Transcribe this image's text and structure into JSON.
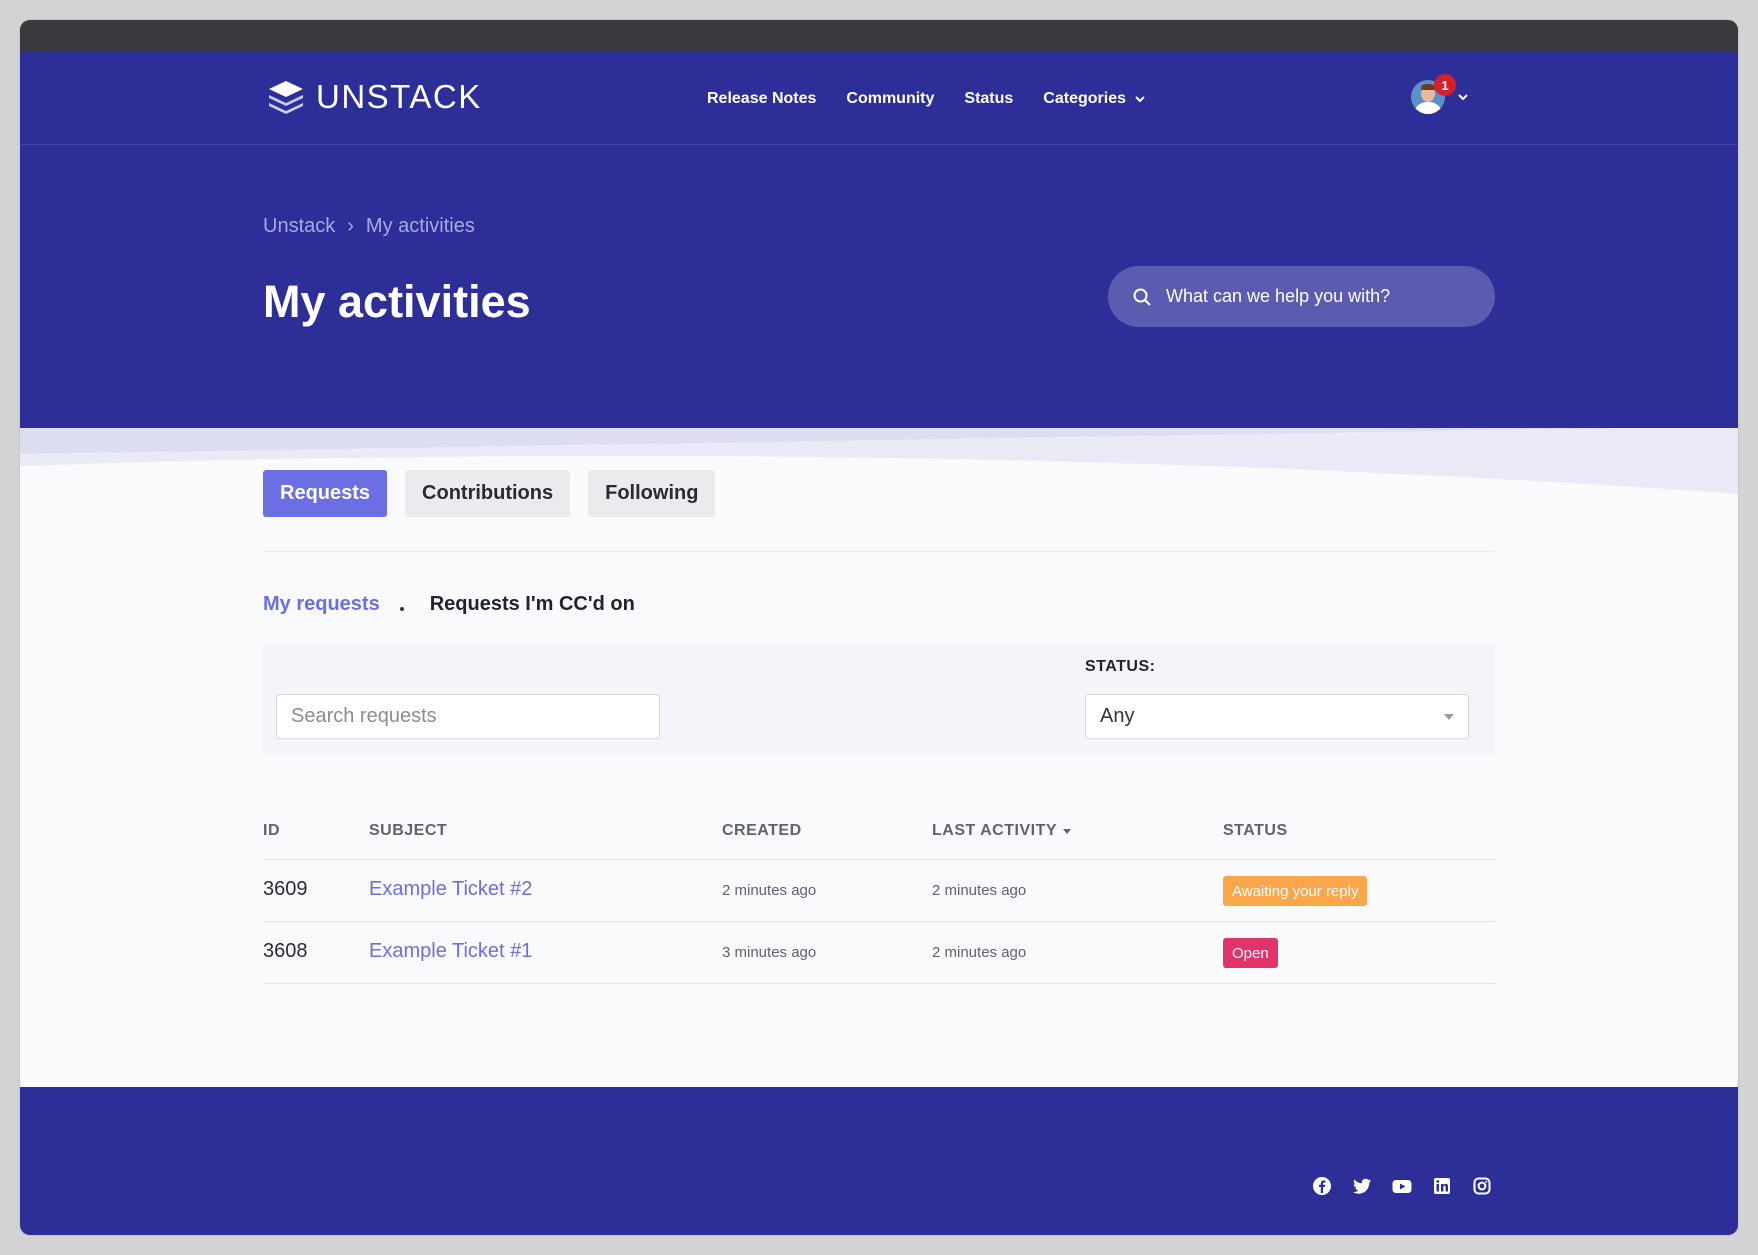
{
  "brand": {
    "name": "UNSTACK",
    "logo_icon": "stacked-layers-logo"
  },
  "nav": {
    "links": [
      "Release Notes",
      "Community",
      "Status",
      "Categories"
    ],
    "notification_count": "1"
  },
  "breadcrumb": {
    "root": "Unstack",
    "separator": "›",
    "current": "My activities"
  },
  "page_title": "My activities",
  "hero_search": {
    "placeholder": "What can we help you with?"
  },
  "tabs": [
    {
      "label": "Requests",
      "active": true
    },
    {
      "label": "Contributions",
      "active": false
    },
    {
      "label": "Following",
      "active": false
    }
  ],
  "subtabs": [
    {
      "label": "My requests",
      "active": true
    },
    {
      "label": "Requests I'm CC'd on",
      "active": false
    }
  ],
  "filters": {
    "search_placeholder": "Search requests",
    "status_label": "STATUS:",
    "status_value": "Any"
  },
  "table": {
    "columns": [
      "ID",
      "SUBJECT",
      "CREATED",
      "LAST ACTIVITY",
      "STATUS"
    ],
    "rows": [
      {
        "id": "3609",
        "subject": "Example Ticket #2",
        "created": "2 minutes ago",
        "last_activity": "2 minutes ago",
        "status": "Awaiting your reply",
        "status_color": "#fba64a"
      },
      {
        "id": "3608",
        "subject": "Example Ticket #1",
        "created": "3 minutes ago",
        "last_activity": "2 minutes ago",
        "status": "Open",
        "status_color": "#e2336b"
      }
    ]
  },
  "footer": {
    "social_icons": [
      "facebook-icon",
      "twitter-icon",
      "youtube-icon",
      "linkedin-icon",
      "instagram-icon"
    ]
  },
  "colors": {
    "primary": "#2d2e97",
    "accent": "#6c6fe3",
    "link": "#6b6ede"
  }
}
